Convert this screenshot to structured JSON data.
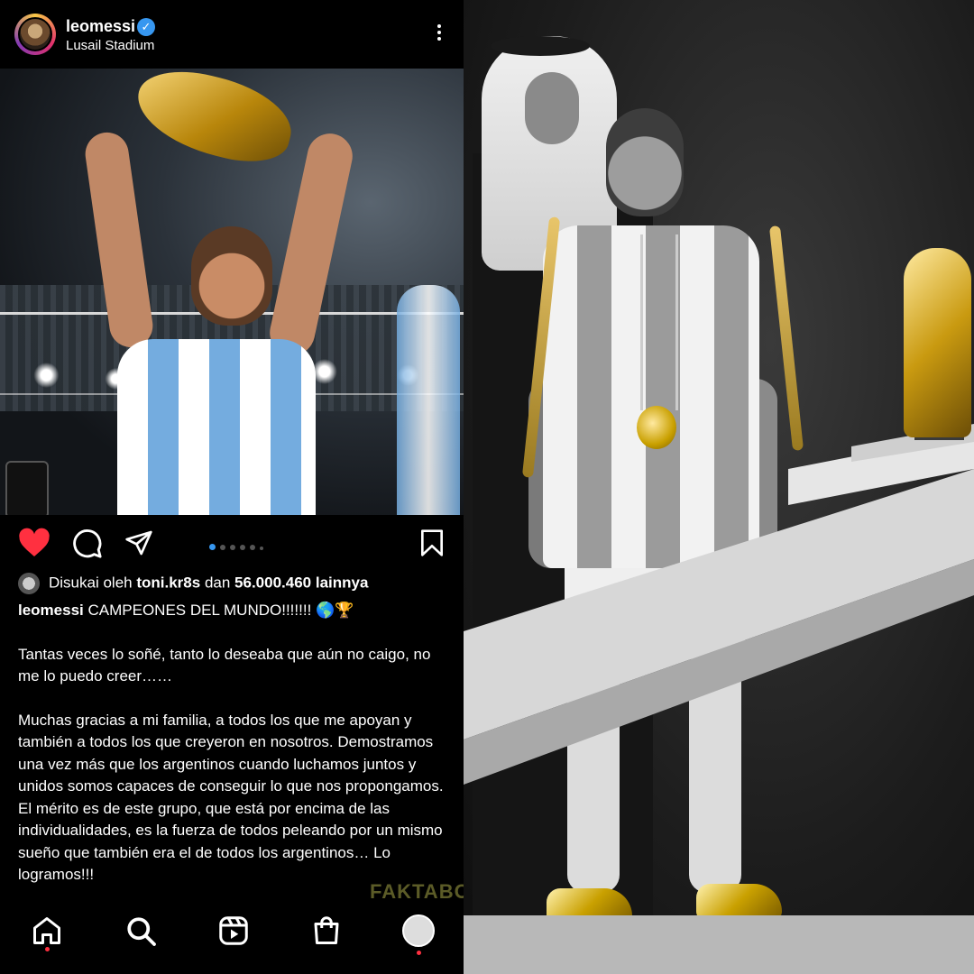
{
  "post": {
    "username": "leomessi",
    "location": "Lusail Stadium",
    "verified": true,
    "carousel_total": 6,
    "carousel_active": 1,
    "likes": {
      "prefix": "Disukai oleh",
      "liker": "toni.kr8s",
      "middle": "dan",
      "count": "56.000.460 lainnya"
    },
    "caption": {
      "username": "leomessi",
      "headline": "CAMPEONES DEL MUNDO!!!!!!! 🌎🏆",
      "paragraph1": "Tantas veces lo soñé, tanto lo deseaba que aún no caigo, no me lo puedo creer……",
      "paragraph2": "Muchas gracias a mi familia, a todos los que me apoyan y también a todos los que creyeron en nosotros. Demostramos una vez más que los argentinos cuando luchamos juntos y unidos somos capaces de conseguir lo que nos propongamos. El mérito es de este grupo, que está por encima de las individualidades, es la fuerza de todos peleando por un mismo sueño que también era el de todos los argentinos… Lo logramos!!!"
    }
  },
  "watermark": "FAKTABOLA",
  "icons": {
    "like": "heart-filled-icon",
    "comment": "comment-icon",
    "share": "send-icon",
    "save": "bookmark-icon",
    "more": "more-vertical-icon",
    "nav": [
      "home-icon",
      "search-icon",
      "reels-icon",
      "shop-icon",
      "profile-icon"
    ]
  },
  "colors": {
    "like": "#ff3040",
    "verified": "#3797f0",
    "carousel_active": "#3797f0",
    "background": "#000000"
  }
}
